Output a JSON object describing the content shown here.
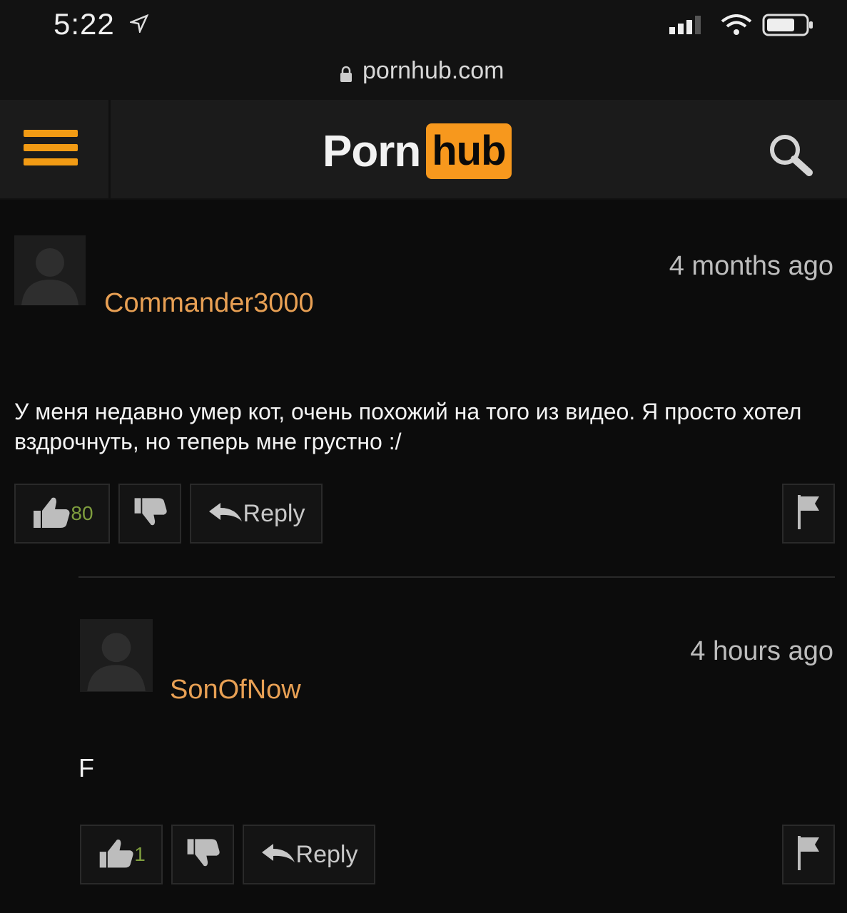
{
  "status_bar": {
    "time": "5:22"
  },
  "browser": {
    "url": "pornhub.com"
  },
  "header": {
    "logo_left": "Porn",
    "logo_right": "hub",
    "accent_color": "#f7981d"
  },
  "comments": [
    {
      "username": "Commander3000",
      "time_ago": "4 months ago",
      "text": "У меня недавно умер кот, очень похожий на того из видео. Я просто хотел вздрочнуть, но теперь мне грустно :/",
      "likes": "80",
      "reply_label": "Reply"
    },
    {
      "username": "SonOfNow",
      "time_ago": "4 hours ago",
      "text": "F",
      "likes": "1",
      "reply_label": "Reply"
    }
  ],
  "icons": [
    "location-arrow-icon",
    "signal-icon",
    "wifi-icon",
    "battery-icon",
    "lock-icon",
    "hamburger-menu-icon",
    "search-icon",
    "avatar-icon",
    "thumbs-up-icon",
    "thumbs-down-icon",
    "reply-arrow-icon",
    "flag-icon"
  ]
}
